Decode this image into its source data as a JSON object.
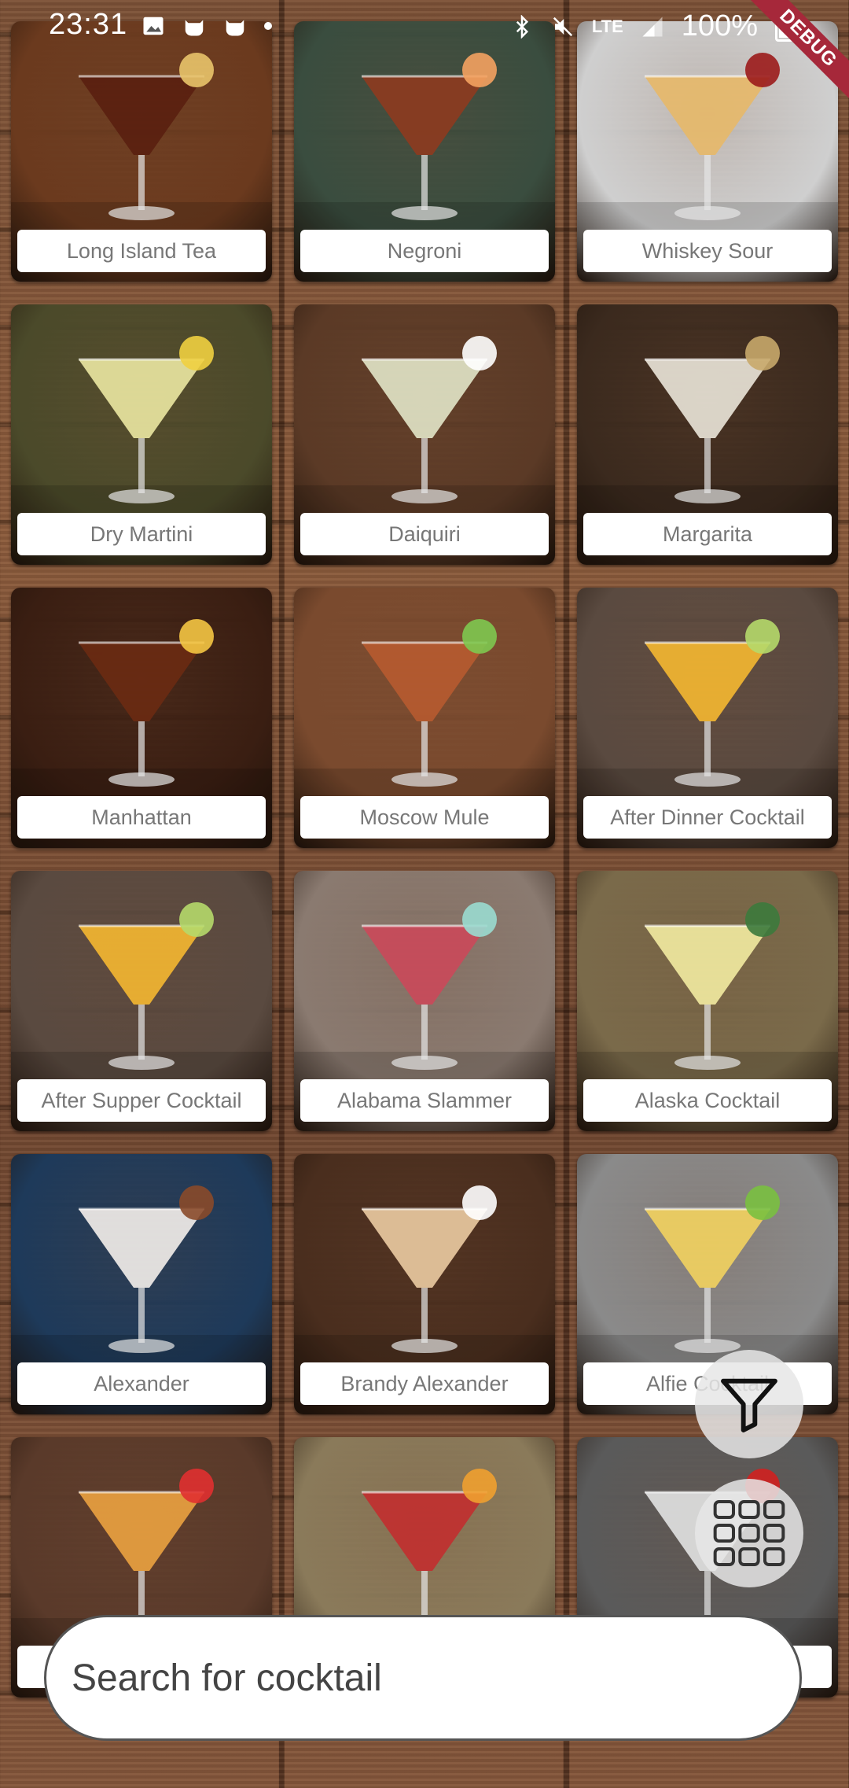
{
  "status_bar": {
    "time": "23:31",
    "battery": "100%",
    "network": "LTE",
    "debug_banner": "DEBUG"
  },
  "cocktails": [
    {
      "name": "Long Island Tea",
      "bg": "#6b3a1e",
      "liquid": "#5a1f10",
      "accent": "#e9c46a"
    },
    {
      "name": "Negroni",
      "bg": "#3a4d3f",
      "liquid": "#8c3b1f",
      "accent": "#f4a261"
    },
    {
      "name": "Whiskey Sour",
      "bg": "#cfcfcf",
      "liquid": "#e6b96a",
      "accent": "#9b1b1b"
    },
    {
      "name": "Dry Martini",
      "bg": "#4b4a2a",
      "liquid": "#e8e4a0",
      "accent": "#f0d040"
    },
    {
      "name": "Daiquiri",
      "bg": "#5b3a26",
      "liquid": "#dfe2c4",
      "accent": "#ffffff"
    },
    {
      "name": "Margarita",
      "bg": "#3b2a1e",
      "liquid": "#e7e2d6",
      "accent": "#c8a96a"
    },
    {
      "name": "Manhattan",
      "bg": "#3a1e12",
      "liquid": "#6a2a12",
      "accent": "#f4c542"
    },
    {
      "name": "Moscow Mule",
      "bg": "#7a4a2e",
      "liquid": "#b55a30",
      "accent": "#7ec850"
    },
    {
      "name": "After Dinner Cocktail",
      "bg": "#5a4a40",
      "liquid": "#f2b531",
      "accent": "#b5d96a"
    },
    {
      "name": "After Supper Cocktail",
      "bg": "#5a4a40",
      "liquid": "#f2b531",
      "accent": "#b5d96a"
    },
    {
      "name": "Alabama Slammer",
      "bg": "#8a7a70",
      "liquid": "#c94a5a",
      "accent": "#9adbd0"
    },
    {
      "name": "Alaska Cocktail",
      "bg": "#7a6a4a",
      "liquid": "#f0e8a0",
      "accent": "#3c7a3c"
    },
    {
      "name": "Alexander",
      "bg": "#1e3a5a",
      "liquid": "#f0ece8",
      "accent": "#8a4a2a"
    },
    {
      "name": "Brandy Alexander",
      "bg": "#4a2e1e",
      "liquid": "#e8c8a0",
      "accent": "#ffffff"
    },
    {
      "name": "Alfie Cocktail",
      "bg": "#8a8a8a",
      "liquid": "#f0d060",
      "accent": "#7ac040"
    },
    {
      "name": "",
      "bg": "#5a3a2a",
      "liquid": "#e8a040",
      "accent": "#e03030"
    },
    {
      "name": "",
      "bg": "#8a7a5a",
      "liquid": "#c03030",
      "accent": "#f0a030"
    },
    {
      "name": "",
      "bg": "#5a5a5a",
      "liquid": "#e0e0e0",
      "accent": "#d02020"
    }
  ],
  "search": {
    "placeholder": "Search for cocktail"
  },
  "fab_filter": {
    "icon": "filter-icon"
  },
  "fab_grid": {
    "icon": "grid-view-icon"
  }
}
